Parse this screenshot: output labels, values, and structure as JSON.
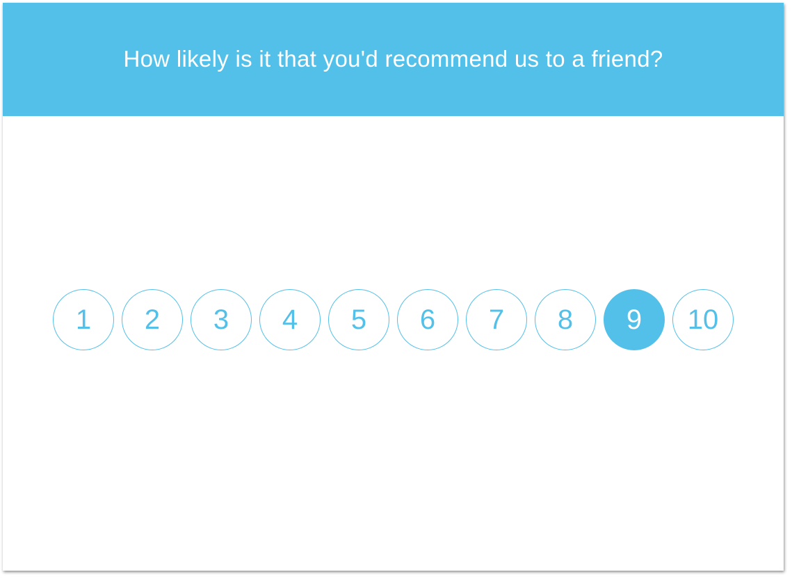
{
  "survey": {
    "question": "How likely is it that you'd recommend us to a friend?",
    "selected": "9",
    "options": [
      "1",
      "2",
      "3",
      "4",
      "5",
      "6",
      "7",
      "8",
      "9",
      "10"
    ]
  },
  "colors": {
    "accent": "#52c0e8",
    "background": "#ffffff",
    "header_text": "#ffffff"
  }
}
